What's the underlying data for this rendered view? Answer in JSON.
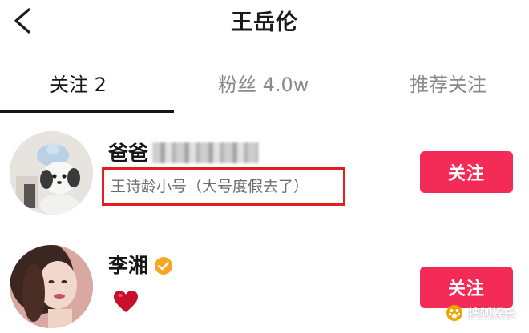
{
  "header": {
    "title": "王岳伦",
    "back_icon": "chevron-left-icon"
  },
  "tabs": [
    {
      "label": "关注 2",
      "active": true
    },
    {
      "label": "粉丝 4.0w",
      "active": false
    },
    {
      "label": "推荐关注",
      "active": false
    }
  ],
  "users": [
    {
      "name": "爸爸",
      "name_obscured": true,
      "bio": "王诗龄小号（大号度假去了）",
      "bio_highlighted": true,
      "follow_label": "关注",
      "avatar_icon": "plush-toy-avatar"
    },
    {
      "name": "李湘",
      "verified_icon": "verified-badge-icon",
      "bio_icon": "heart-icon",
      "follow_label": "关注",
      "avatar_icon": "portrait-avatar"
    }
  ],
  "watermark": {
    "text": "搜狐娱乐",
    "icon": "paw-logo-icon"
  },
  "colors": {
    "accent": "#f42b57",
    "highlight_box": "#e02020",
    "verified": "#f5a623",
    "heart": "#c8102e"
  }
}
